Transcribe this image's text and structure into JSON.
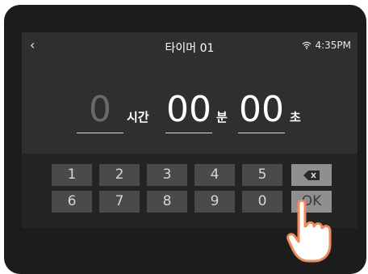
{
  "header": {
    "back_icon": "chevron-left-icon",
    "back_glyph": "‹",
    "title": "타이머 01",
    "time": "4:35PM",
    "wifi_icon": "wifi-icon"
  },
  "timer": {
    "hours": "0",
    "hours_unit": "시간",
    "minutes": "00",
    "minutes_unit": "분",
    "seconds": "00",
    "seconds_unit": "초"
  },
  "keypad": {
    "row1": [
      "1",
      "2",
      "3",
      "4",
      "5"
    ],
    "row2": [
      "6",
      "7",
      "8",
      "9",
      "0"
    ],
    "backspace_icon": "backspace-icon",
    "ok_label": "OK"
  },
  "overlay": {
    "pointer_icon": "hand-pointer-icon"
  },
  "colors": {
    "device": "#1c1c1c",
    "screen": "#2f2f2f",
    "key": "#4a4a4a",
    "key_active": "#8f8f8f",
    "hand": "#f08a5d"
  }
}
